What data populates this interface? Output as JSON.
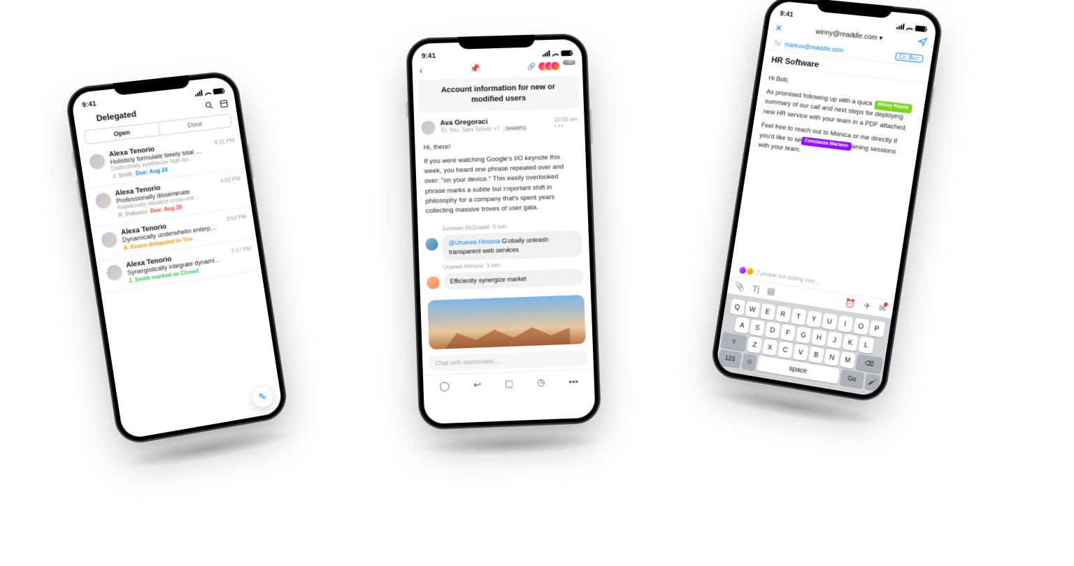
{
  "status_time": "9:41",
  "phone1": {
    "title": "Delegated",
    "seg_open": "Open",
    "seg_done": "Done",
    "rows": [
      {
        "name": "Alexa Tenorio",
        "subj": "Holisticly formulate timely total …",
        "prev": "Distinctively synthesize high-qu…",
        "assignee": "J. Smith",
        "due": "Due: Aug 24",
        "due_cls": "due-b",
        "time": "9:21 PM"
      },
      {
        "name": "Alexa Tenorio",
        "subj": "Professionally disseminate",
        "prev": "Rapidiously visualize cross-unit …",
        "assignee": "R. Pollastro",
        "due": "Due: Aug 20",
        "due_cls": "due-r",
        "time": "4:03 PM"
      },
      {
        "name": "Alexa Tenorio",
        "subj": "Dynamically underwhelm enterp…",
        "prev": "",
        "status": "A. Evans delegated to You",
        "status_cls": "deleg",
        "time": "3:53 PM"
      },
      {
        "name": "Alexa Tenorio",
        "subj": "Synergistically integrate dynami…",
        "prev": "",
        "status": "J. Smith marked as Closed",
        "status_cls": "closed",
        "time": "2:17 PM"
      }
    ]
  },
  "phone2": {
    "avatar_badge": "+99",
    "subject": "Account information for new or modified users",
    "sender": "Ava Gregoraci",
    "to": "To: You, Sara Scholz +7",
    "shared": "SHARED",
    "received": "10:00 am",
    "greeting": "Hi, there!",
    "paragraph": "If you were watching Google's I/O keynote this week, you heard one phrase repeated over and over: \"on your device.\" This easily overlooked phrase marks a subtle but important shift in philosophy for a company that's spent years collecting massive troves of user gata.",
    "chat": [
      {
        "name": "Jushawn McDowell",
        "time": "5 min",
        "mention": "@Uruewa Himona",
        "text": " Globally unleash transparent web services"
      },
      {
        "name": "Uruewa Himona",
        "time": "3 min",
        "mention": "",
        "text": "Efficiently synergize market"
      }
    ],
    "chat_placeholder": "Chat with teammates…"
  },
  "phone3": {
    "from": "winny@readdle.com",
    "to_label": "To:",
    "to": "markus@readdle.com",
    "ccbcc": "Cc: Bcc:",
    "subject": "HR Software",
    "greeting": "Hi Bob,",
    "p1a": "As promised following up with a quick",
    "tag1": "Winny Rearie",
    "p1b": "summary of our call and next steps for deploying new HR service with your team in a PDF attached.",
    "p2a": "Feel free to reach out to Monica or me directly if you'd like to se",
    "tag2": "Constanza Mariano",
    "p2b": "aining sessions with your team.",
    "editing": "2 people are editing now…",
    "kb": {
      "r1": [
        "Q",
        "W",
        "E",
        "R",
        "T",
        "Y",
        "U",
        "I",
        "O",
        "P"
      ],
      "r2": [
        "A",
        "S",
        "D",
        "F",
        "G",
        "H",
        "J",
        "K",
        "L"
      ],
      "r3": [
        "Z",
        "X",
        "C",
        "V",
        "B",
        "N",
        "M"
      ],
      "shift": "⇧",
      "del": "⌫",
      "num": "123",
      "space": "space",
      "go": "Go",
      "emoji": "☺",
      "mic": "🎤"
    }
  }
}
